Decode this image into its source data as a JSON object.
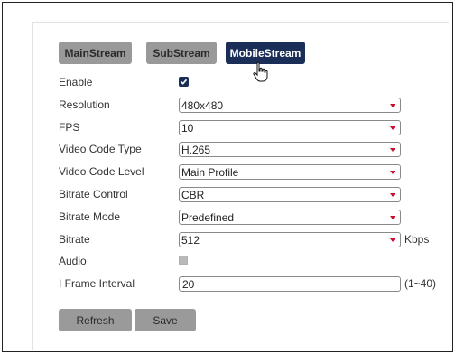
{
  "tabs": [
    {
      "label": "MainStream",
      "active": false
    },
    {
      "label": "SubStream",
      "active": false
    },
    {
      "label": "MobileStream",
      "active": true
    }
  ],
  "fields": {
    "enable": {
      "label": "Enable",
      "checked": true
    },
    "resolution": {
      "label": "Resolution",
      "value": "480x480"
    },
    "fps": {
      "label": "FPS",
      "value": "10"
    },
    "video_code_type": {
      "label": "Video Code Type",
      "value": "H.265"
    },
    "video_code_level": {
      "label": "Video Code Level",
      "value": "Main Profile"
    },
    "bitrate_control": {
      "label": "Bitrate Control",
      "value": "CBR"
    },
    "bitrate_mode": {
      "label": "Bitrate Mode",
      "value": "Predefined"
    },
    "bitrate": {
      "label": "Bitrate",
      "value": "512",
      "unit": "Kbps"
    },
    "audio": {
      "label": "Audio",
      "checked": false
    },
    "i_frame_interval": {
      "label": "I Frame Interval",
      "value": "20",
      "range": "(1~40)"
    }
  },
  "buttons": {
    "refresh": "Refresh",
    "save": "Save"
  },
  "colors": {
    "tab_inactive": "#999999",
    "tab_active": "#1a2e57",
    "dropdown_arrow": "#c8102e",
    "button_bg": "#9a9a9a"
  }
}
